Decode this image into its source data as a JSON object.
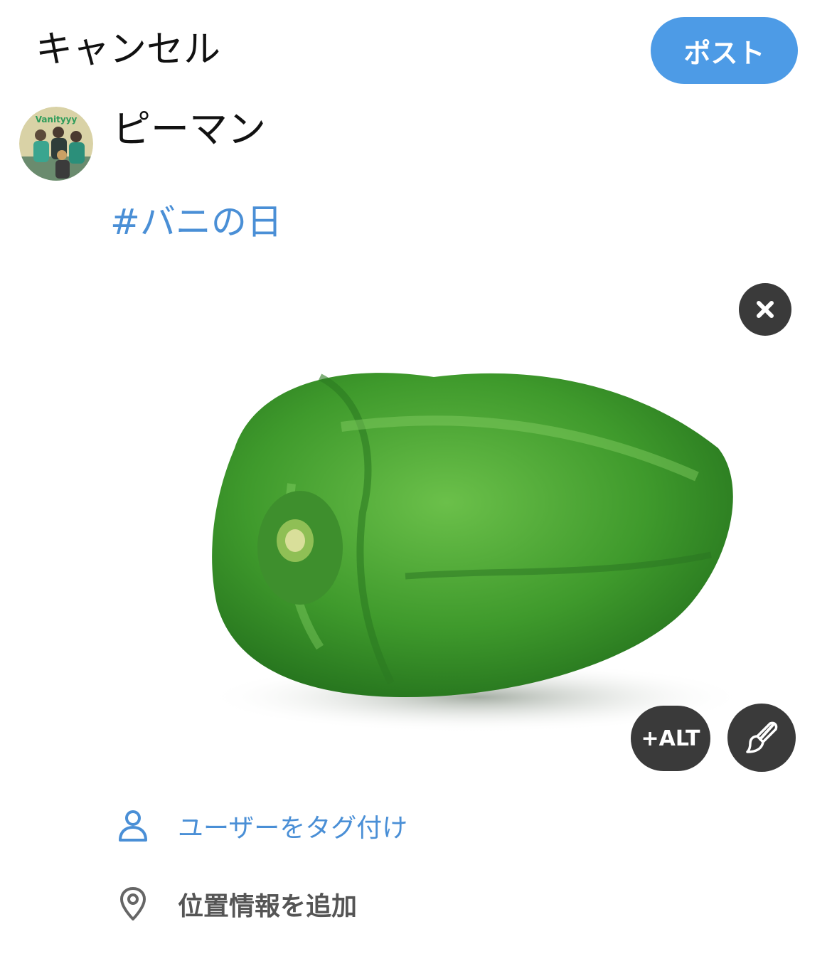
{
  "header": {
    "cancel_label": "キャンセル",
    "post_label": "ポスト"
  },
  "composer": {
    "avatar_icon": "avatar",
    "avatar_text": "Vanityyy",
    "pill_label": "ピーマン",
    "text": "#バニの日"
  },
  "media": {
    "subject": "green-bell-pepper",
    "remove_icon": "close-icon",
    "alt_label": "+ALT",
    "edit_icon": "brush-icon"
  },
  "actions": {
    "tag_users_label": "ユーザーをタグ付け",
    "tag_users_icon": "person-icon",
    "add_location_label": "位置情報を追加",
    "add_location_icon": "location-pin-icon"
  },
  "colors": {
    "accent": "#4d9be6",
    "link": "#4a8fd6",
    "overlay_button": "#3a3a3a"
  }
}
